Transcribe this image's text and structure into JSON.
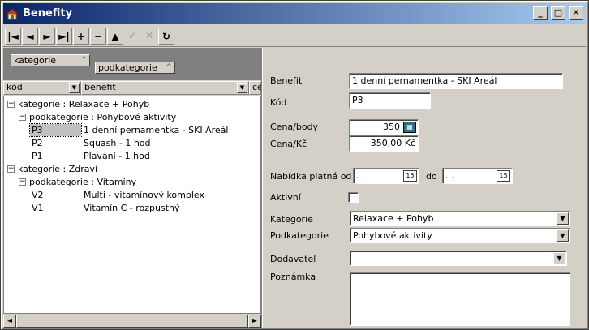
{
  "window": {
    "title": "Benefity",
    "app_icon": "house-icon"
  },
  "titlebar_buttons": {
    "minimize": "_",
    "maximize": "□",
    "close": "✕"
  },
  "toolbar": {
    "first": "|◄",
    "prev": "◄",
    "next": "►",
    "last": "►|",
    "add": "+",
    "delete": "−",
    "edit": "▲",
    "post": "✓",
    "cancel": "✕",
    "refresh": "↻"
  },
  "grouping": {
    "level1": "kategorie",
    "level2": "podkategorie",
    "sort_glyph": "^"
  },
  "grid": {
    "col_code": "kód",
    "col_benefit": "benefit",
    "col_extra": "ce",
    "dropdown_glyph": "▼",
    "expanded_glyph": "−",
    "rows": [
      {
        "kind": "group",
        "text": "kategorie : Relaxace + Pohyb"
      },
      {
        "kind": "subgroup",
        "text": "podkategorie : Pohybové aktivity"
      },
      {
        "kind": "item",
        "code": "P3",
        "benefit": "1 denní pernamentka - SKI Areál",
        "selected": true
      },
      {
        "kind": "item",
        "code": "P2",
        "benefit": "Squash - 1 hod"
      },
      {
        "kind": "item",
        "code": "P1",
        "benefit": "Plavání - 1 hod"
      },
      {
        "kind": "group",
        "text": "kategorie : Zdraví"
      },
      {
        "kind": "subgroup",
        "text": "podkategorie : Vitamíny"
      },
      {
        "kind": "item",
        "code": "V2",
        "benefit": "Multi - vitamínový komplex"
      },
      {
        "kind": "item",
        "code": "V1",
        "benefit": "Vitamín C - rozpustný"
      }
    ]
  },
  "scroll": {
    "left": "◄",
    "right": "►"
  },
  "form": {
    "benefit_label": "Benefit",
    "benefit_value": "1 denní pernamentka - SKI Areál",
    "kod_label": "Kód",
    "kod_value": "P3",
    "cena_body_label": "Cena/body",
    "cena_body_value": "350",
    "cena_kc_label": "Cena/Kč",
    "cena_kc_value": "350,00 Kč",
    "nabidka_label": "Nabídka platná od",
    "nabidka_od_value": ". .",
    "do_label": "do",
    "nabidka_do_value": ". .",
    "calendar_glyph": "15",
    "calculator_glyph": "▦",
    "aktivni_label": "Aktivní",
    "aktivni_checked": false,
    "kategorie_label": "Kategorie",
    "kategorie_value": "Relaxace + Pohyb",
    "podkategorie_label": "Podkategorie",
    "podkategorie_value": "Pohybové aktivity",
    "dodavatel_label": "Dodavatel",
    "dodavatel_value": "",
    "poznamka_label": "Poznámka",
    "poznamka_value": "",
    "dropdown_glyph": "▼"
  }
}
